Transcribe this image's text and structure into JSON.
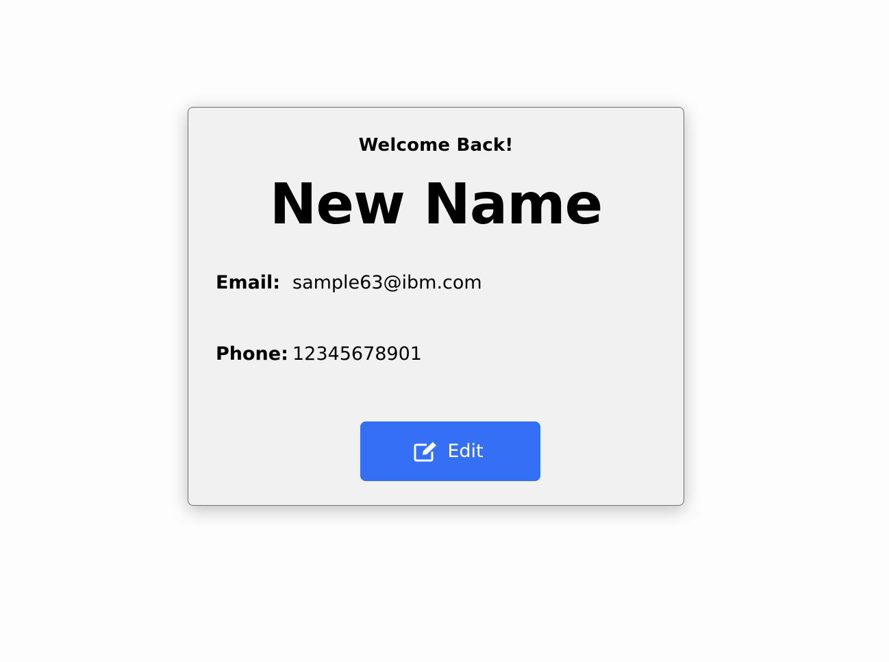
{
  "profile": {
    "greeting": "Welcome Back!",
    "name": "New Name",
    "email_label": "Email:",
    "email_value": "sample63@ibm.com",
    "phone_label": "Phone:",
    "phone_value": "12345678901"
  },
  "actions": {
    "edit_label": "Edit",
    "edit_icon": "edit-icon"
  },
  "colors": {
    "card_bg": "#f1f1f1",
    "button_bg": "#3370f3",
    "button_text": "#ffffff"
  }
}
